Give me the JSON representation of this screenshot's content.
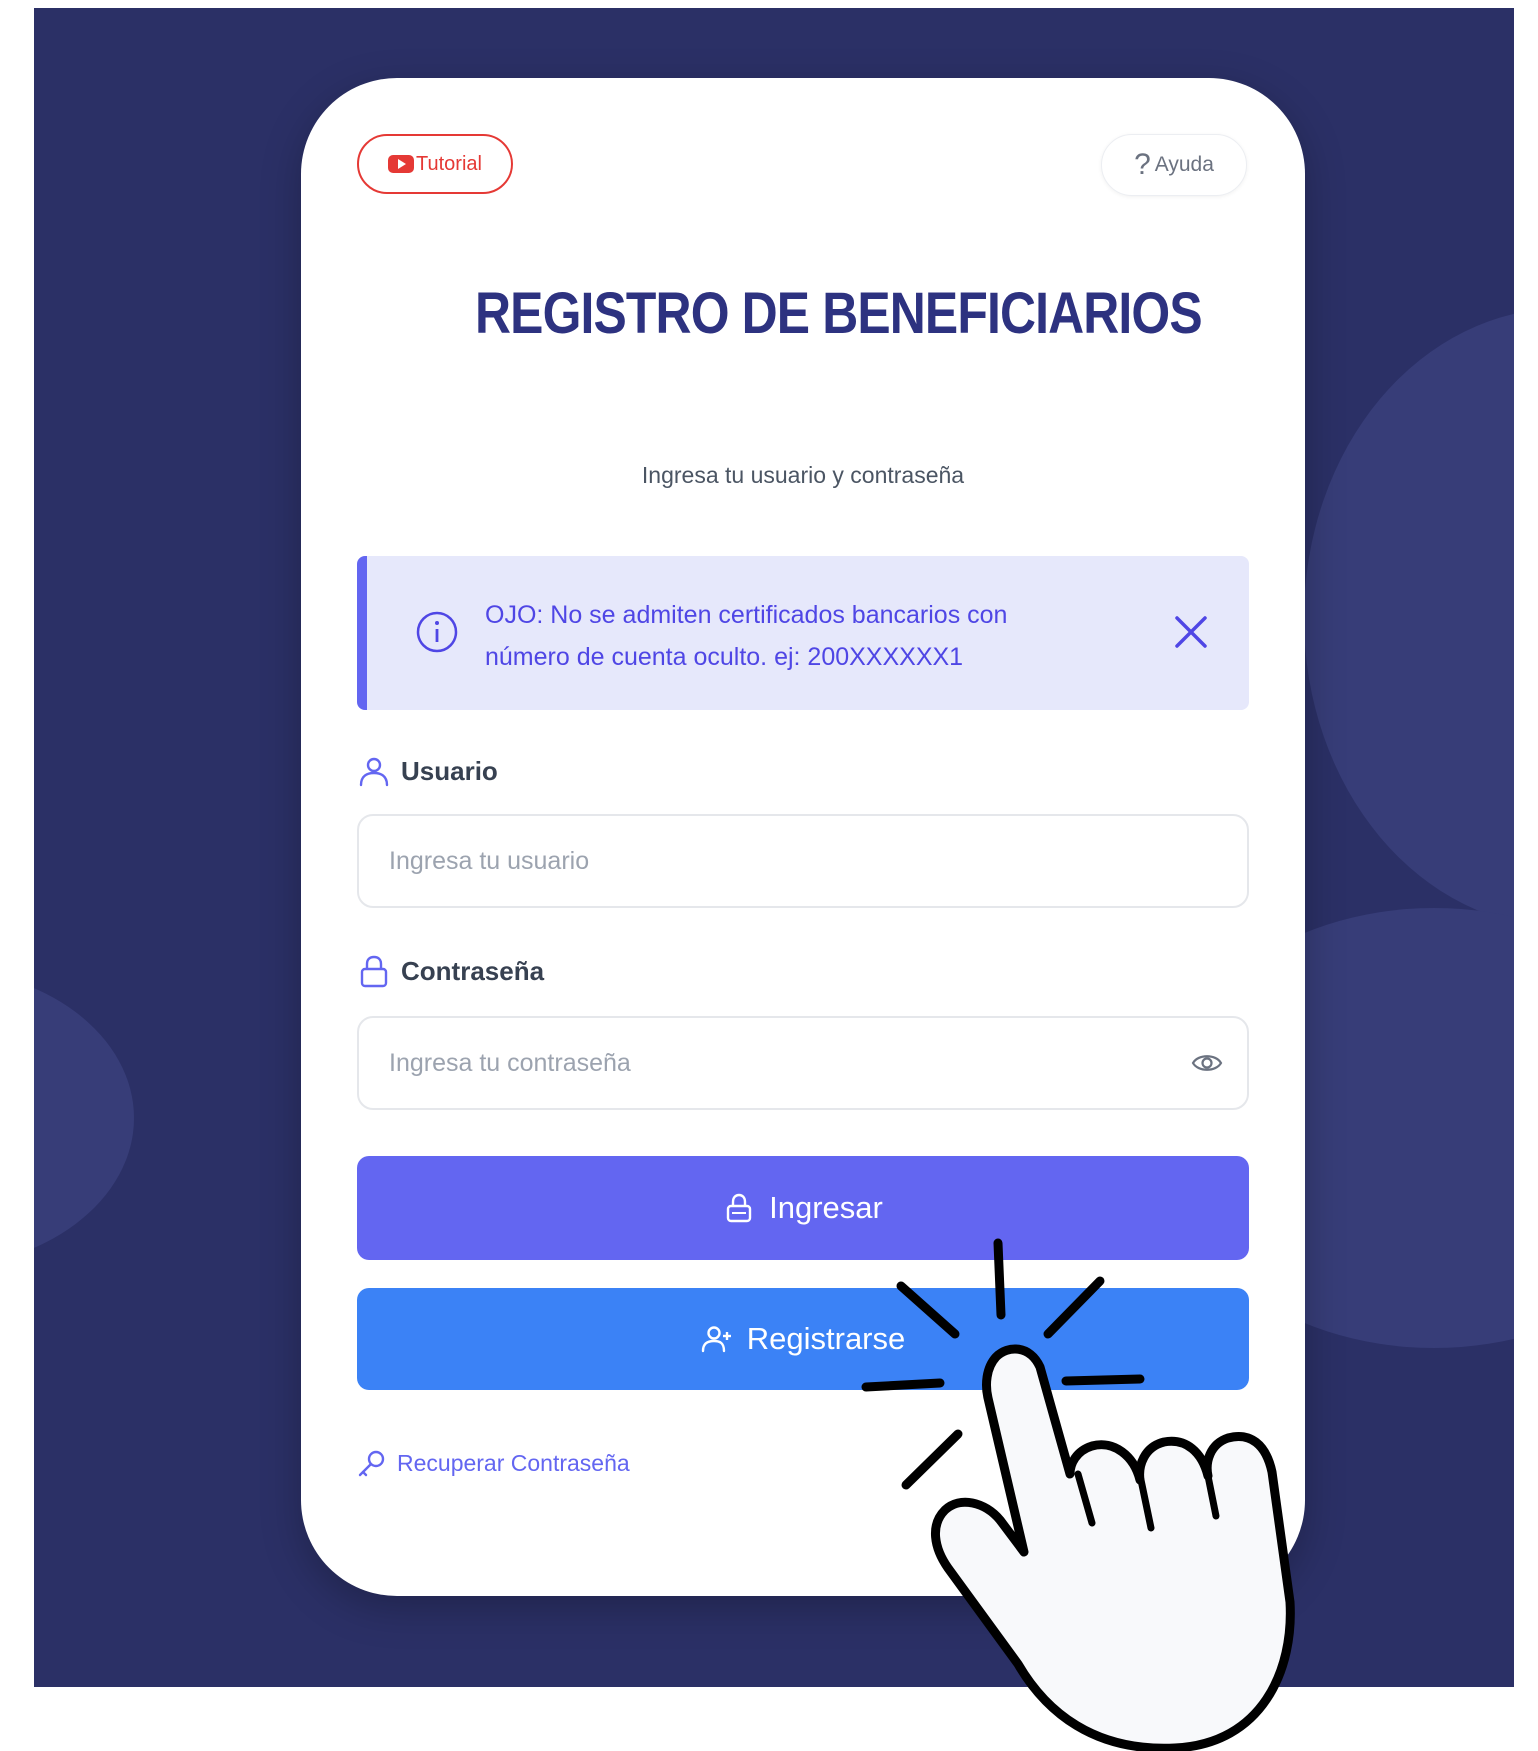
{
  "header": {
    "tutorial_label": "Tutorial",
    "help_label": "Ayuda"
  },
  "logo": {
    "title": "REGISTRO DE BENEFICIARIOS"
  },
  "subtitle": "Ingresa tu usuario y contraseña",
  "alert": {
    "line1": "OJO: No se admiten certificados bancarios con",
    "line2": "número de cuenta oculto. ej: 200XXXXXX1"
  },
  "form": {
    "user_label": "Usuario",
    "user_placeholder": "Ingresa tu usuario",
    "password_label": "Contraseña",
    "password_placeholder": "Ingresa tu contraseña"
  },
  "actions": {
    "login_label": "Ingresar",
    "register_label": "Registrarse",
    "recover_label": "Recuperar Contraseña"
  },
  "icons": {
    "tutorial": "youtube-icon",
    "help": "question-mark-icon",
    "alert": "info-icon",
    "close": "close-icon",
    "user": "user-icon",
    "password": "lock-icon",
    "toggle_password": "eye-icon",
    "register": "user-plus-icon",
    "recover": "key-icon",
    "overlay": "pointing-hand-cursor-icon"
  },
  "colors": {
    "background": "#2b3066",
    "logo_text": "#2d3280",
    "logo_stripes": "#f5c518",
    "alert_bg": "#e6e8fb",
    "alert_accent": "#6366f1",
    "login_button": "#6366f1",
    "register_button": "#3b82f6",
    "tutorial_border": "#e53935"
  }
}
